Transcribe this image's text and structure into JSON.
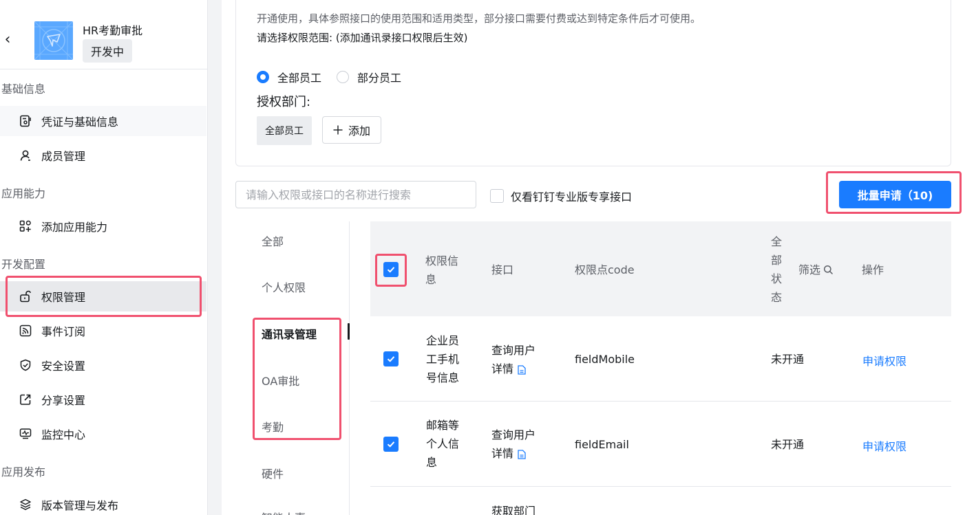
{
  "app": {
    "name": "HR考勤审批",
    "status": "开发中"
  },
  "sidebar": {
    "sections": [
      {
        "title": "基础信息",
        "items": [
          {
            "label": "凭证与基础信息"
          },
          {
            "label": "成员管理"
          }
        ]
      },
      {
        "title": "应用能力",
        "items": [
          {
            "label": "添加应用能力"
          }
        ]
      },
      {
        "title": "开发配置",
        "items": [
          {
            "label": "权限管理"
          },
          {
            "label": "事件订阅"
          },
          {
            "label": "安全设置"
          },
          {
            "label": "分享设置"
          },
          {
            "label": "监控中心"
          }
        ]
      },
      {
        "title": "应用发布",
        "items": [
          {
            "label": "版本管理与发布"
          }
        ]
      }
    ]
  },
  "scope": {
    "description": "开通使用，具体参照接口的使用范围和适用类型，部分接口需要付费或达到特定条件后才可使用。",
    "label": "请选择权限范围:  (添加通讯录接口权限后生效)",
    "options": [
      "全部员工",
      "部分员工"
    ],
    "selected": "全部员工",
    "dept_label": "授权部门:",
    "dept_tag": "全部员工",
    "add_label": "添加"
  },
  "toolbar": {
    "search_placeholder": "请输入权限或接口的名称进行搜索",
    "pro_only_label": "仅看钉钉专业版专享接口",
    "batch_button": "批量申请（10)"
  },
  "categories": [
    "全部",
    "个人权限",
    "通讯录管理",
    "OA审批",
    "考勤",
    "硬件",
    "智能人事"
  ],
  "active_category": "通讯录管理",
  "table": {
    "headers": {
      "info": [
        "权限信",
        "息"
      ],
      "api": "接口",
      "code": "权限点code",
      "status": [
        "全",
        "部",
        "状",
        "态"
      ],
      "filter": "筛选",
      "action": "操作"
    },
    "rows": [
      {
        "info": [
          "企业员",
          "工手机",
          "号信息"
        ],
        "api": [
          "查询用户",
          "详情"
        ],
        "code": "fieldMobile",
        "status": "未开通",
        "action": "申请权限"
      },
      {
        "info": [
          "邮箱等",
          "个人信",
          "息"
        ],
        "api": [
          "查询用户",
          "详情"
        ],
        "code": "fieldEmail",
        "status": "未开通",
        "action": "申请权限"
      },
      {
        "api": [
          "获取部门"
        ]
      }
    ]
  },
  "colors": {
    "primary": "#1a7cff",
    "highlight": "#f0506e"
  }
}
